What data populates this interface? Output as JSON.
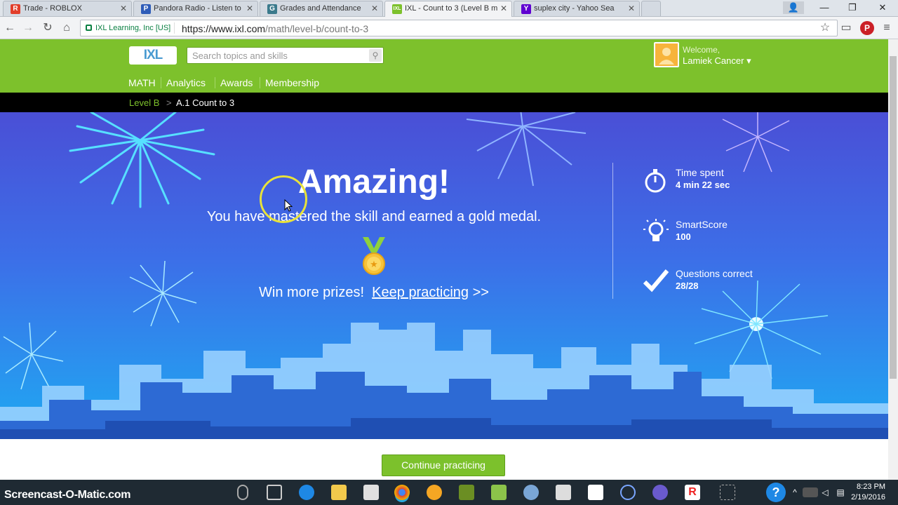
{
  "browser": {
    "tabs": [
      {
        "title": "Trade - ROBLOX",
        "favicon": "R"
      },
      {
        "title": "Pandora Radio - Listen to",
        "favicon": "P"
      },
      {
        "title": "Grades and Attendance",
        "favicon": "G"
      },
      {
        "title": "IXL - Count to 3 (Level B m",
        "favicon": "IXL",
        "active": true
      },
      {
        "title": "suplex city - Yahoo Sea",
        "favicon": "Y"
      }
    ],
    "security_label": "IXL Learning, Inc [US]",
    "url_host": "https://www.ixl.com",
    "url_path": "/math/level-b/count-to-3"
  },
  "header": {
    "logo": "IXL",
    "search_placeholder": "Search topics and skills",
    "welcome": "Welcome,",
    "user_name": "Lamiek Cancer",
    "nav": [
      "MATH",
      "Analytics",
      "Awards",
      "Membership"
    ]
  },
  "breadcrumb": {
    "level": "Level B",
    "separator": ">",
    "skill": "A.1 Count to 3"
  },
  "result": {
    "headline": "Amazing!",
    "message": "You have mastered the skill and earned a gold medal.",
    "prizes_text": "Win more prizes!",
    "keep_practicing": "Keep practicing",
    "arrows": ">>"
  },
  "stats": [
    {
      "label": "Time spent",
      "value": "4 min 22 sec",
      "icon": "stopwatch-icon"
    },
    {
      "label": "SmartScore",
      "value": "100",
      "icon": "lightbulb-icon"
    },
    {
      "label": "Questions correct",
      "value": "28/28",
      "icon": "checkmark-icon"
    }
  ],
  "continue_label": "Continue practicing",
  "taskbar": {
    "watermark": "Screencast-O-Matic.com",
    "time": "8:23 PM",
    "date": "2/19/2016"
  },
  "colors": {
    "ixl_green": "#7dc12c",
    "hero_top": "#4a4fd6",
    "hero_bottom": "#1fa9f2"
  }
}
